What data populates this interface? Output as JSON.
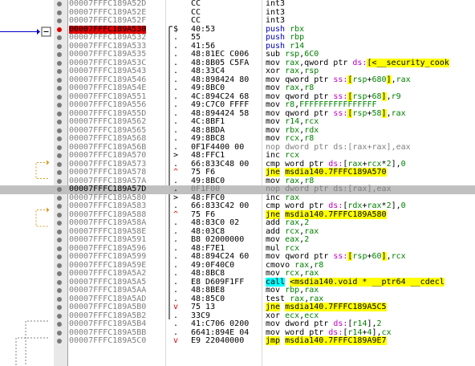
{
  "rows": [
    {
      "addr": "00007FFFC189A52D",
      "mark": "",
      "bytes": "CC",
      "mn": "int3",
      "cls": "cc",
      "ops": []
    },
    {
      "addr": "00007FFFC189A52E",
      "mark": "",
      "bytes": "CC",
      "mn": "int3",
      "cls": "cc",
      "ops": []
    },
    {
      "addr": "00007FFFC189A52F",
      "mark": "",
      "bytes": "CC",
      "mn": "int3",
      "cls": "cc",
      "ops": []
    },
    {
      "addr": "00007FFFC189A530",
      "mark": "$",
      "bytes": "40:53",
      "mn": "push",
      "cls": "push",
      "ops": [
        [
          "reg",
          "rbx"
        ]
      ],
      "ip": true
    },
    {
      "addr": "00007FFFC189A532",
      "mark": ".",
      "bytes": "55",
      "mn": "push",
      "cls": "push",
      "ops": [
        [
          "reg",
          "rbp"
        ]
      ]
    },
    {
      "addr": "00007FFFC189A533",
      "mark": ".",
      "bytes": "41:56",
      "mn": "push",
      "cls": "push",
      "ops": [
        [
          "reg",
          "r14"
        ]
      ]
    },
    {
      "addr": "00007FFFC189A535",
      "mark": ".",
      "bytes": "48:81EC C006",
      "mn": "sub",
      "cls": "",
      "ops": [
        [
          "reg",
          "rsp"
        ],
        [
          "t",
          ","
        ],
        [
          "num",
          "6C0"
        ]
      ]
    },
    {
      "addr": "00007FFFC189A53C",
      "mark": ".",
      "bytes": "48:8B05 C5FA",
      "mn": "mov",
      "cls": "",
      "ops": [
        [
          "reg",
          "rax"
        ],
        [
          "t",
          ",qword ptr "
        ],
        [
          "seg",
          "ds:"
        ],
        [
          "hl",
          "[<__security_cook"
        ]
      ]
    },
    {
      "addr": "00007FFFC189A543",
      "mark": ".",
      "bytes": "48:33C4",
      "mn": "xor",
      "cls": "",
      "ops": [
        [
          "reg",
          "rax"
        ],
        [
          "t",
          ","
        ],
        [
          "reg",
          "rsp"
        ]
      ]
    },
    {
      "addr": "00007FFFC189A546",
      "mark": ".",
      "bytes": "48:898424 80",
      "mn": "mov",
      "cls": "",
      "ops": [
        [
          "t",
          "qword ptr "
        ],
        [
          "seg",
          "ss:"
        ],
        [
          "hl",
          "["
        ],
        [
          "reg",
          "rsp"
        ],
        [
          "t",
          "+"
        ],
        [
          "num",
          "680"
        ],
        [
          "hl",
          "]"
        ],
        [
          "t",
          ","
        ],
        [
          "reg",
          "rax"
        ]
      ]
    },
    {
      "addr": "00007FFFC189A54E",
      "mark": ".",
      "bytes": "49:8BC0",
      "mn": "mov",
      "cls": "",
      "ops": [
        [
          "reg",
          "rax"
        ],
        [
          "t",
          ","
        ],
        [
          "reg",
          "r8"
        ]
      ]
    },
    {
      "addr": "00007FFFC189A551",
      "mark": ".",
      "bytes": "4C:894C24 68",
      "mn": "mov",
      "cls": "",
      "ops": [
        [
          "t",
          "qword ptr "
        ],
        [
          "seg",
          "ss:"
        ],
        [
          "hl",
          "["
        ],
        [
          "reg",
          "rsp"
        ],
        [
          "t",
          "+"
        ],
        [
          "num",
          "68"
        ],
        [
          "hl",
          "]"
        ],
        [
          "t",
          ","
        ],
        [
          "reg",
          "r9"
        ]
      ]
    },
    {
      "addr": "00007FFFC189A556",
      "mark": ".",
      "bytes": "49:C7C0 FFFF",
      "mn": "mov",
      "cls": "",
      "ops": [
        [
          "reg",
          "r8"
        ],
        [
          "t",
          ","
        ],
        [
          "num",
          "FFFFFFFFFFFFFFFF"
        ]
      ]
    },
    {
      "addr": "00007FFFC189A55D",
      "mark": ".",
      "bytes": "48:894424 58",
      "mn": "mov",
      "cls": "",
      "ops": [
        [
          "t",
          "qword ptr "
        ],
        [
          "seg",
          "ss:"
        ],
        [
          "hl",
          "["
        ],
        [
          "reg",
          "rsp"
        ],
        [
          "t",
          "+"
        ],
        [
          "num",
          "58"
        ],
        [
          "hl",
          "]"
        ],
        [
          "t",
          ","
        ],
        [
          "reg",
          "rax"
        ]
      ]
    },
    {
      "addr": "00007FFFC189A562",
      "mark": ".",
      "bytes": "4C:8BF1",
      "mn": "mov",
      "cls": "",
      "ops": [
        [
          "reg",
          "r14"
        ],
        [
          "t",
          ","
        ],
        [
          "reg",
          "rcx"
        ]
      ]
    },
    {
      "addr": "00007FFFC189A565",
      "mark": ".",
      "bytes": "48:8BDA",
      "mn": "mov",
      "cls": "",
      "ops": [
        [
          "reg",
          "rbx"
        ],
        [
          "t",
          ","
        ],
        [
          "reg",
          "rdx"
        ]
      ]
    },
    {
      "addr": "00007FFFC189A568",
      "mark": ".",
      "bytes": "49:8BC8",
      "mn": "mov",
      "cls": "",
      "ops": [
        [
          "reg",
          "rcx"
        ],
        [
          "t",
          ","
        ],
        [
          "reg",
          "r8"
        ]
      ]
    },
    {
      "addr": "00007FFFC189A56B",
      "mark": ".",
      "bytes": "0F1F4400 00",
      "mn": "nop",
      "cls": "nop",
      "ops": [
        [
          "gray",
          "dword ptr ds:[rax+rax],eax"
        ]
      ]
    },
    {
      "addr": "00007FFFC189A570",
      "mark": ">",
      "bytes": "48:FFC1",
      "mn": "inc",
      "cls": "",
      "ops": [
        [
          "reg",
          "rcx"
        ]
      ]
    },
    {
      "addr": "00007FFFC189A573",
      "mark": ".",
      "bytes": "66:833C48 00",
      "mn": "cmp",
      "cls": "",
      "ops": [
        [
          "t",
          "word ptr "
        ],
        [
          "seg",
          "ds:"
        ],
        [
          "t",
          "["
        ],
        [
          "reg",
          "rax"
        ],
        [
          "t",
          "+"
        ],
        [
          "reg",
          "rcx"
        ],
        [
          "t",
          "*"
        ],
        [
          "num",
          "2"
        ],
        [
          "t",
          "],"
        ],
        [
          "num",
          "0"
        ]
      ]
    },
    {
      "addr": "00007FFFC189A578",
      "mark": "^",
      "bytes": "75 F6",
      "mn": "jne",
      "cls": "jcc",
      "ops": [
        [
          "tgt",
          "msdia140.7FFFC189A570"
        ]
      ]
    },
    {
      "addr": "00007FFFC189A57A",
      "mark": ".",
      "bytes": "49:8BC0",
      "mn": "mov",
      "cls": "",
      "ops": [
        [
          "reg",
          "rax"
        ],
        [
          "t",
          ","
        ],
        [
          "reg",
          "r8"
        ]
      ]
    },
    {
      "addr": "00007FFFC189A57D",
      "mark": ".",
      "bytes": "0F1F00",
      "mn": "nop",
      "cls": "nop",
      "ops": [
        [
          "gray",
          "dword ptr ds:[rax],eax"
        ]
      ],
      "current": true
    },
    {
      "addr": "00007FFFC189A580",
      "mark": ">",
      "bytes": "48:FFC0",
      "mn": "inc",
      "cls": "",
      "ops": [
        [
          "reg",
          "rax"
        ]
      ]
    },
    {
      "addr": "00007FFFC189A583",
      "mark": ".",
      "bytes": "66:833C42 00",
      "mn": "cmp",
      "cls": "",
      "ops": [
        [
          "t",
          "word ptr "
        ],
        [
          "seg",
          "ds:"
        ],
        [
          "t",
          "["
        ],
        [
          "reg",
          "rdx"
        ],
        [
          "t",
          "+"
        ],
        [
          "reg",
          "rax"
        ],
        [
          "t",
          "*"
        ],
        [
          "num",
          "2"
        ],
        [
          "t",
          "],"
        ],
        [
          "num",
          "0"
        ]
      ]
    },
    {
      "addr": "00007FFFC189A588",
      "mark": "^",
      "bytes": "75 F6",
      "mn": "jne",
      "cls": "jcc",
      "ops": [
        [
          "tgt",
          "msdia140.7FFFC189A580"
        ]
      ]
    },
    {
      "addr": "00007FFFC189A58A",
      "mark": ".",
      "bytes": "48:83C0 02",
      "mn": "add",
      "cls": "",
      "ops": [
        [
          "reg",
          "rax"
        ],
        [
          "t",
          ","
        ],
        [
          "num",
          "2"
        ]
      ]
    },
    {
      "addr": "00007FFFC189A58E",
      "mark": ".",
      "bytes": "48:03C8",
      "mn": "add",
      "cls": "",
      "ops": [
        [
          "reg",
          "rcx"
        ],
        [
          "t",
          ","
        ],
        [
          "reg",
          "rax"
        ]
      ]
    },
    {
      "addr": "00007FFFC189A591",
      "mark": ".",
      "bytes": "B8 02000000",
      "mn": "mov",
      "cls": "",
      "ops": [
        [
          "reg",
          "eax"
        ],
        [
          "t",
          ","
        ],
        [
          "num",
          "2"
        ]
      ]
    },
    {
      "addr": "00007FFFC189A596",
      "mark": ".",
      "bytes": "48:F7E1",
      "mn": "mul",
      "cls": "",
      "ops": [
        [
          "reg",
          "rcx"
        ]
      ]
    },
    {
      "addr": "00007FFFC189A599",
      "mark": ".",
      "bytes": "48:894C24 60",
      "mn": "mov",
      "cls": "",
      "ops": [
        [
          "t",
          "qword ptr "
        ],
        [
          "seg",
          "ss:"
        ],
        [
          "hl",
          "["
        ],
        [
          "reg",
          "rsp"
        ],
        [
          "t",
          "+"
        ],
        [
          "num",
          "60"
        ],
        [
          "hl",
          "]"
        ],
        [
          "t",
          ","
        ],
        [
          "reg",
          "rcx"
        ]
      ]
    },
    {
      "addr": "00007FFFC189A59E",
      "mark": ".",
      "bytes": "49:0F40C0",
      "mn": "cmovo",
      "cls": "",
      "ops": [
        [
          "reg",
          "rax"
        ],
        [
          "t",
          ","
        ],
        [
          "reg",
          "r8"
        ]
      ]
    },
    {
      "addr": "00007FFFC189A5A2",
      "mark": ".",
      "bytes": "48:8BC8",
      "mn": "mov",
      "cls": "",
      "ops": [
        [
          "reg",
          "rcx"
        ],
        [
          "t",
          ","
        ],
        [
          "reg",
          "rax"
        ]
      ]
    },
    {
      "addr": "00007FFFC189A5A5",
      "mark": ".",
      "bytes": "E8 D609F1FF",
      "mn": "call",
      "cls": "callk",
      "ops": [
        [
          "hl",
          "<msdia140.void * __ptr64 __cdecl"
        ]
      ]
    },
    {
      "addr": "00007FFFC189A5AA",
      "mark": ".",
      "bytes": "48:8BE8",
      "mn": "mov",
      "cls": "",
      "ops": [
        [
          "reg",
          "rbp"
        ],
        [
          "t",
          ","
        ],
        [
          "reg",
          "rax"
        ]
      ]
    },
    {
      "addr": "00007FFFC189A5AD",
      "mark": ".",
      "bytes": "48:85C0",
      "mn": "test",
      "cls": "",
      "ops": [
        [
          "reg",
          "rax"
        ],
        [
          "t",
          ","
        ],
        [
          "reg",
          "rax"
        ]
      ]
    },
    {
      "addr": "00007FFFC189A5B0",
      "mark": "v",
      "bytes": "75 13",
      "mn": "jne",
      "cls": "jcc",
      "ops": [
        [
          "tgt",
          "msdia140.7FFFC189A5C5"
        ]
      ]
    },
    {
      "addr": "00007FFFC189A5B2",
      "mark": ".",
      "bytes": "33C9",
      "mn": "xor",
      "cls": "",
      "ops": [
        [
          "reg",
          "ecx"
        ],
        [
          "t",
          ","
        ],
        [
          "reg",
          "ecx"
        ]
      ]
    },
    {
      "addr": "00007FFFC189A5B4",
      "mark": ".",
      "bytes": "41:C706 0200",
      "mn": "mov",
      "cls": "",
      "ops": [
        [
          "t",
          "dword ptr "
        ],
        [
          "seg",
          "ds:"
        ],
        [
          "t",
          "["
        ],
        [
          "reg",
          "r14"
        ],
        [
          "t",
          "],"
        ],
        [
          "num",
          "2"
        ]
      ]
    },
    {
      "addr": "00007FFFC189A5BB",
      "mark": ".",
      "bytes": "6641:894E 04",
      "mn": "mov",
      "cls": "",
      "ops": [
        [
          "t",
          "word ptr "
        ],
        [
          "seg",
          "ds:"
        ],
        [
          "t",
          "["
        ],
        [
          "reg",
          "r14"
        ],
        [
          "t",
          "+"
        ],
        [
          "num",
          "4"
        ],
        [
          "t",
          "],"
        ],
        [
          "reg",
          "cx"
        ]
      ]
    },
    {
      "addr": "00007FFFC189A5C0",
      "mark": "v",
      "bytes": "E9 22040000",
      "mn": "jmp",
      "cls": "jcc",
      "ops": [
        [
          "tgt",
          "msdia140.7FFFC189A9E7"
        ]
      ]
    }
  ],
  "colors": {
    "ip_marker": "#e00000",
    "breakpoint_dot": "#7a7a7a",
    "jump_highlight": "#ffff00",
    "call_highlight": "#00ffff"
  }
}
